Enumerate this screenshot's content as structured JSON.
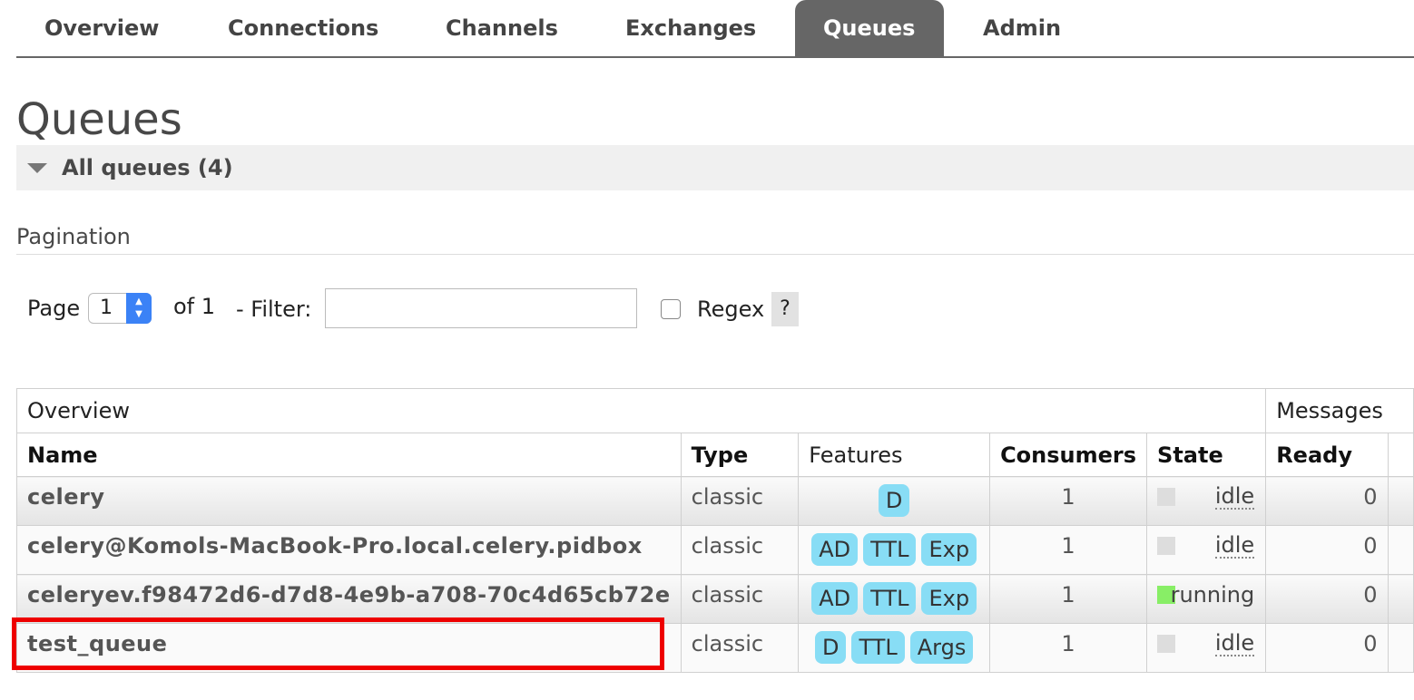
{
  "nav": {
    "tabs": [
      {
        "label": "Overview",
        "active": false
      },
      {
        "label": "Connections",
        "active": false
      },
      {
        "label": "Channels",
        "active": false
      },
      {
        "label": "Exchanges",
        "active": false
      },
      {
        "label": "Queues",
        "active": true
      },
      {
        "label": "Admin",
        "active": false
      }
    ]
  },
  "page": {
    "title": "Queues",
    "section_title": "All queues (4)",
    "pagination_label": "Pagination"
  },
  "pagination": {
    "page_label": "Page",
    "page_value": "1",
    "of_label": "of 1",
    "filter_label": "- Filter:",
    "filter_value": "",
    "regex_label": "Regex",
    "regex_checked": false,
    "help_label": "?"
  },
  "table": {
    "groups": {
      "overview": "Overview",
      "messages": "Messages"
    },
    "columns": {
      "name": "Name",
      "type": "Type",
      "features": "Features",
      "consumers": "Consumers",
      "state": "State",
      "ready": "Ready"
    },
    "rows": [
      {
        "name": "celery",
        "type": "classic",
        "features": [
          "D"
        ],
        "consumers": "1",
        "state": "idle",
        "ready": "0"
      },
      {
        "name": "celery@Komols-MacBook-Pro.local.celery.pidbox",
        "type": "classic",
        "features": [
          "AD",
          "TTL",
          "Exp"
        ],
        "consumers": "1",
        "state": "idle",
        "ready": "0"
      },
      {
        "name": "celeryev.f98472d6-d7d8-4e9b-a708-70c4d65cb72e",
        "type": "classic",
        "features": [
          "AD",
          "TTL",
          "Exp"
        ],
        "consumers": "1",
        "state": "running",
        "ready": "0"
      },
      {
        "name": "test_queue",
        "type": "classic",
        "features": [
          "D",
          "TTL",
          "Args"
        ],
        "consumers": "1",
        "state": "idle",
        "ready": "0"
      }
    ]
  },
  "colors": {
    "active_tab": "#666666",
    "badge": "#88ddf5",
    "state_running": "#88ee66",
    "state_idle": "#dddddd",
    "highlight": "#ee0000"
  }
}
